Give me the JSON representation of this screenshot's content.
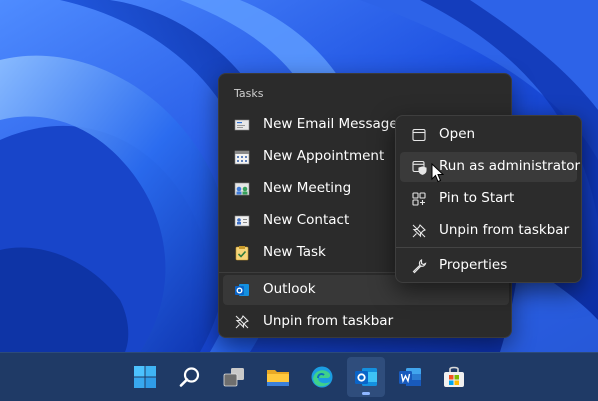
{
  "jumplist": {
    "heading": "Tasks",
    "tasks": [
      {
        "label": "New Email Message",
        "icon": "email-icon"
      },
      {
        "label": "New Appointment",
        "icon": "calendar-icon"
      },
      {
        "label": "New Meeting",
        "icon": "meeting-icon"
      },
      {
        "label": "New Contact",
        "icon": "contact-icon"
      },
      {
        "label": "New Task",
        "icon": "task-icon"
      }
    ],
    "app": {
      "label": "Outlook",
      "icon": "outlook-icon"
    },
    "unpin": {
      "label": "Unpin from taskbar",
      "icon": "unpin-icon"
    }
  },
  "context_menu": {
    "items": [
      {
        "label": "Open",
        "icon": "window-icon"
      },
      {
        "label": "Run as administrator",
        "icon": "admin-shield-icon"
      },
      {
        "label": "Pin to Start",
        "icon": "pin-start-icon"
      },
      {
        "label": "Unpin from taskbar",
        "icon": "unpin-icon"
      },
      {
        "label": "Properties",
        "icon": "wrench-icon"
      }
    ]
  },
  "taskbar": {
    "items": [
      {
        "name": "start",
        "icon": "windows-logo-icon"
      },
      {
        "name": "search",
        "icon": "search-icon"
      },
      {
        "name": "task-view",
        "icon": "task-view-icon"
      },
      {
        "name": "file-explorer",
        "icon": "folder-icon"
      },
      {
        "name": "edge",
        "icon": "edge-icon"
      },
      {
        "name": "outlook",
        "icon": "outlook-icon",
        "active": true
      },
      {
        "name": "word",
        "icon": "word-icon"
      },
      {
        "name": "store",
        "icon": "store-icon"
      }
    ]
  },
  "colors": {
    "menu_bg": "#2b2b2b",
    "taskbar_bg": "#1f3a66",
    "accent": "#0a64d6",
    "wallpaper": "#1b4fd8"
  }
}
